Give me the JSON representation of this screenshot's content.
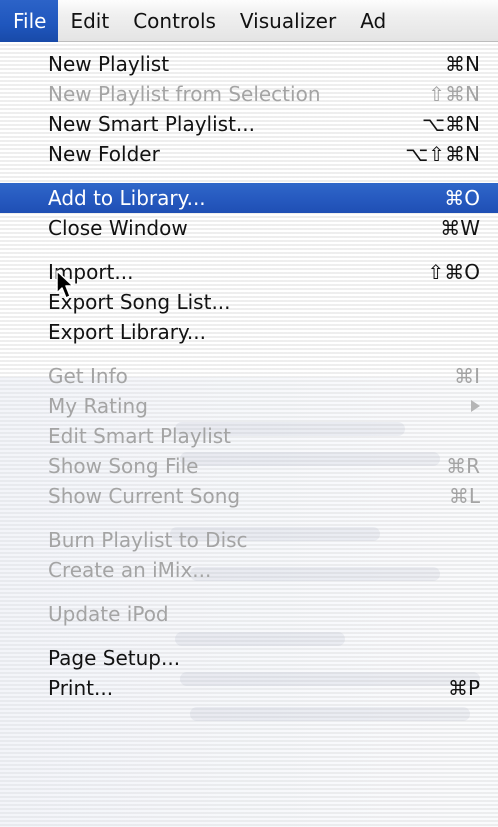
{
  "menubar": {
    "items": [
      {
        "label": "File"
      },
      {
        "label": "Edit"
      },
      {
        "label": "Controls"
      },
      {
        "label": "Visualizer"
      },
      {
        "label": "Ad"
      }
    ]
  },
  "menu": {
    "sections": [
      [
        {
          "label": "New Playlist",
          "shortcut": "⌘N",
          "enabled": true
        },
        {
          "label": "New Playlist from Selection",
          "shortcut": "⇧⌘N",
          "enabled": false
        },
        {
          "label": "New Smart Playlist...",
          "shortcut": "⌥⌘N",
          "enabled": true
        },
        {
          "label": "New Folder",
          "shortcut": "⌥⇧⌘N",
          "enabled": true
        }
      ],
      [
        {
          "label": "Add to Library...",
          "shortcut": "⌘O",
          "enabled": true,
          "highlight": true
        },
        {
          "label": "Close Window",
          "shortcut": "⌘W",
          "enabled": true
        }
      ],
      [
        {
          "label": "Import...",
          "shortcut": "⇧⌘O",
          "enabled": true
        },
        {
          "label": "Export Song List...",
          "shortcut": "",
          "enabled": true
        },
        {
          "label": "Export Library...",
          "shortcut": "",
          "enabled": true
        }
      ],
      [
        {
          "label": "Get Info",
          "shortcut": "⌘I",
          "enabled": false
        },
        {
          "label": "My Rating",
          "shortcut": "",
          "enabled": false,
          "submenu": true
        },
        {
          "label": "Edit Smart Playlist",
          "shortcut": "",
          "enabled": false
        },
        {
          "label": "Show Song File",
          "shortcut": "⌘R",
          "enabled": false
        },
        {
          "label": "Show Current Song",
          "shortcut": "⌘L",
          "enabled": false
        }
      ],
      [
        {
          "label": "Burn Playlist to Disc",
          "shortcut": "",
          "enabled": false
        },
        {
          "label": "Create an iMix...",
          "shortcut": "",
          "enabled": false
        }
      ],
      [
        {
          "label": "Update iPod",
          "shortcut": "",
          "enabled": false
        }
      ],
      [
        {
          "label": "Page Setup...",
          "shortcut": "",
          "enabled": true
        },
        {
          "label": "Print...",
          "shortcut": "⌘P",
          "enabled": true
        }
      ]
    ]
  },
  "colors": {
    "highlight": "#2659bf",
    "enabled_text": "#121212",
    "disabled_text": "#a4a4a4"
  },
  "icons": {
    "cursor": "arrow-pointer-icon",
    "submenu": "submenu-triangle-icon"
  }
}
